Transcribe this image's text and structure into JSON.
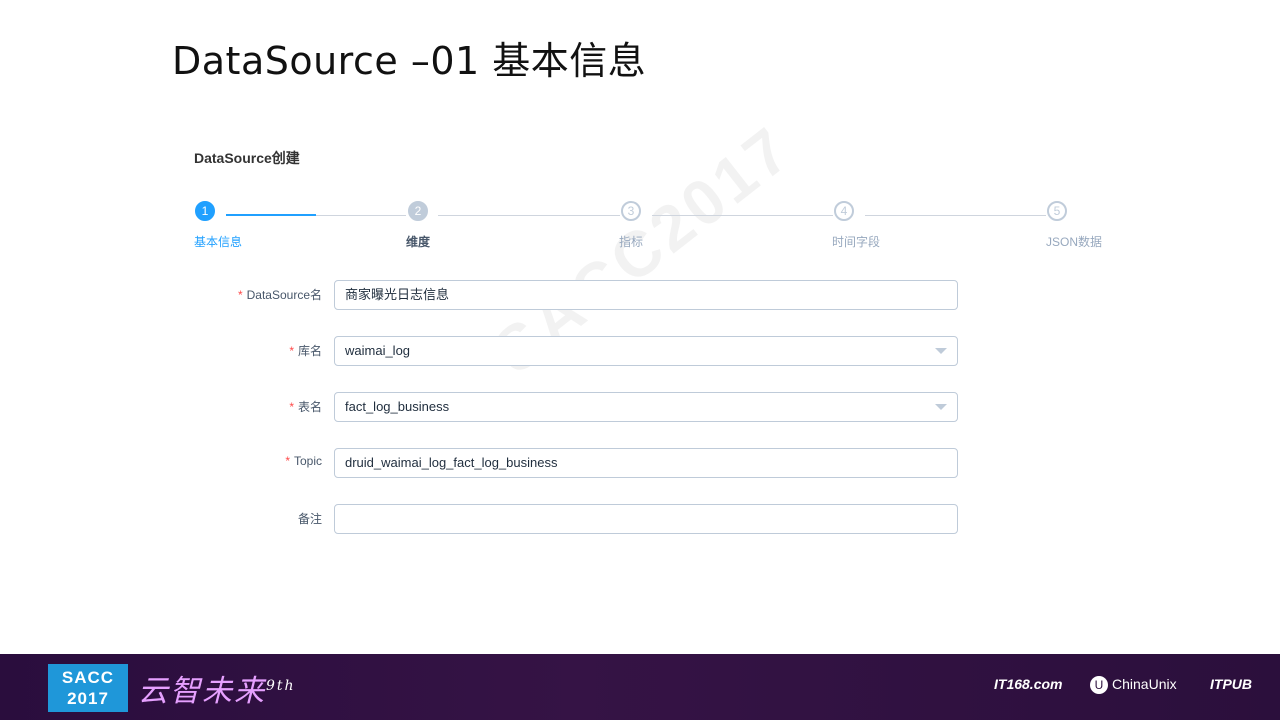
{
  "slide": {
    "title": "DataSource –01 基本信息"
  },
  "panel": {
    "title": "DataSource创建"
  },
  "steps": [
    {
      "num": "1",
      "label": "基本信息",
      "state": "done"
    },
    {
      "num": "2",
      "label": "维度",
      "state": "current"
    },
    {
      "num": "3",
      "label": "指标",
      "state": "todo"
    },
    {
      "num": "4",
      "label": "时间字段",
      "state": "todo"
    },
    {
      "num": "5",
      "label": "JSON数据",
      "state": "todo"
    }
  ],
  "form": {
    "required_mark": "*",
    "datasource_name": {
      "label": "DataSource名",
      "value": "商家曝光日志信息"
    },
    "db_name": {
      "label": "库名",
      "value": "waimai_log"
    },
    "table_name": {
      "label": "表名",
      "value": "fact_log_business"
    },
    "topic": {
      "label": "Topic",
      "value": "druid_waimai_log_fact_log_business"
    },
    "remark": {
      "label": "备注",
      "value": ""
    }
  },
  "watermark": "SACC2017",
  "footer": {
    "logo_line1": "SACC",
    "logo_line2": "2017",
    "slogan": "云智未来",
    "edition": "9th",
    "partners": [
      "IT168.com",
      "ChinaUnix",
      "ITPUB"
    ]
  },
  "colors": {
    "accent": "#20a0ff",
    "step_inactive": "#c0ccda",
    "required": "#ff4949",
    "footer_bg": "#2f1141"
  }
}
